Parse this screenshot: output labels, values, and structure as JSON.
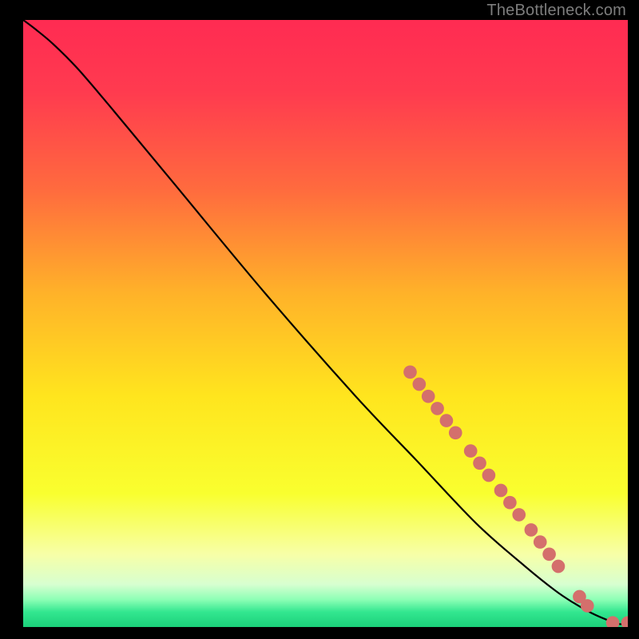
{
  "attribution": "TheBottleneck.com",
  "chart_data": {
    "type": "line",
    "title": "",
    "xlabel": "",
    "ylabel": "",
    "xlim": [
      0,
      100
    ],
    "ylim": [
      0,
      100
    ],
    "background_gradient_stops": [
      {
        "offset": 0.0,
        "color": "#ff2b52"
      },
      {
        "offset": 0.12,
        "color": "#ff3b4f"
      },
      {
        "offset": 0.28,
        "color": "#ff6b3e"
      },
      {
        "offset": 0.45,
        "color": "#ffb229"
      },
      {
        "offset": 0.62,
        "color": "#ffe51e"
      },
      {
        "offset": 0.78,
        "color": "#f9ff2f"
      },
      {
        "offset": 0.88,
        "color": "#f7ffa7"
      },
      {
        "offset": 0.93,
        "color": "#d7ffd0"
      },
      {
        "offset": 0.955,
        "color": "#8cffb5"
      },
      {
        "offset": 0.975,
        "color": "#33e790"
      },
      {
        "offset": 1.0,
        "color": "#1bd07a"
      }
    ],
    "series": [
      {
        "name": "curve",
        "stroke": "#000000",
        "x": [
          0.0,
          2.0,
          5.0,
          9.0,
          15.0,
          25.0,
          40.0,
          55.0,
          65.0,
          75.0,
          83.0,
          88.0,
          91.0,
          94.0,
          96.5,
          98.5,
          100.0
        ],
        "y": [
          100.0,
          98.5,
          96.0,
          92.0,
          85.0,
          73.0,
          55.0,
          38.0,
          27.5,
          17.0,
          10.0,
          6.0,
          4.0,
          2.3,
          1.2,
          0.5,
          0.5
        ]
      }
    ],
    "markers": {
      "name": "highlighted-segment",
      "color": "#d46f6c",
      "radius_frac": 0.011,
      "points": [
        {
          "x": 64.0,
          "y": 42.0
        },
        {
          "x": 65.5,
          "y": 40.0
        },
        {
          "x": 67.0,
          "y": 38.0
        },
        {
          "x": 68.5,
          "y": 36.0
        },
        {
          "x": 70.0,
          "y": 34.0
        },
        {
          "x": 71.5,
          "y": 32.0
        },
        {
          "x": 74.0,
          "y": 29.0
        },
        {
          "x": 75.5,
          "y": 27.0
        },
        {
          "x": 77.0,
          "y": 25.0
        },
        {
          "x": 79.0,
          "y": 22.5
        },
        {
          "x": 80.5,
          "y": 20.5
        },
        {
          "x": 82.0,
          "y": 18.5
        },
        {
          "x": 84.0,
          "y": 16.0
        },
        {
          "x": 85.5,
          "y": 14.0
        },
        {
          "x": 87.0,
          "y": 12.0
        },
        {
          "x": 88.5,
          "y": 10.0
        },
        {
          "x": 92.0,
          "y": 5.0
        },
        {
          "x": 93.3,
          "y": 3.5
        },
        {
          "x": 97.5,
          "y": 0.7
        },
        {
          "x": 100.0,
          "y": 0.7
        }
      ]
    }
  }
}
